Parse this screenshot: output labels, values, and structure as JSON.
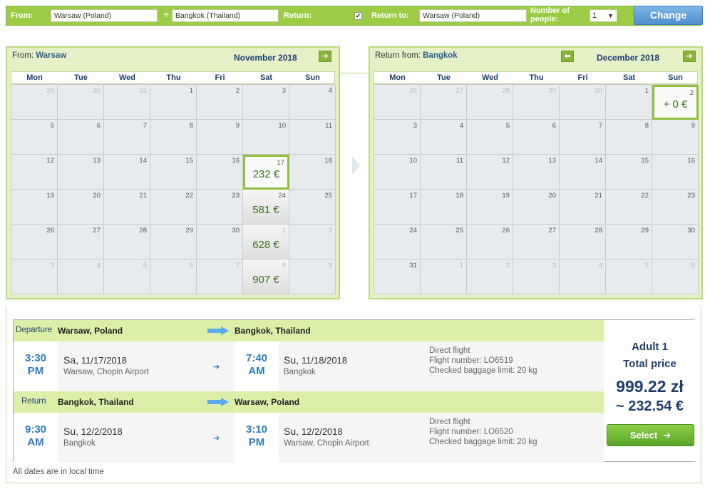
{
  "search": {
    "from_label": "From:",
    "from_value": "Warsaw (Poland)",
    "to_value": "Bangkok (Thailand)",
    "return_label": "Return:",
    "return_checked": true,
    "return_to_label": "Return to:",
    "return_to_value": "Warsaw (Poland)",
    "people_label": "Number of people:",
    "people_value": "1",
    "change_label": "Change"
  },
  "weekdays": [
    "Mon",
    "Tue",
    "Wed",
    "Thu",
    "Fri",
    "Sat",
    "Sun"
  ],
  "outbound_calendar": {
    "prefix": "From:",
    "city": "Warsaw",
    "month": "November 2018",
    "cells": [
      {
        "d": "29",
        "o": true
      },
      {
        "d": "30",
        "o": true
      },
      {
        "d": "31",
        "o": true
      },
      {
        "d": "1"
      },
      {
        "d": "2"
      },
      {
        "d": "3"
      },
      {
        "d": "4"
      },
      {
        "d": "5"
      },
      {
        "d": "6"
      },
      {
        "d": "7"
      },
      {
        "d": "8"
      },
      {
        "d": "9"
      },
      {
        "d": "10"
      },
      {
        "d": "11"
      },
      {
        "d": "12"
      },
      {
        "d": "13"
      },
      {
        "d": "14"
      },
      {
        "d": "15"
      },
      {
        "d": "16"
      },
      {
        "d": "17",
        "p": "232 €",
        "s": true
      },
      {
        "d": "18"
      },
      {
        "d": "19"
      },
      {
        "d": "20"
      },
      {
        "d": "21"
      },
      {
        "d": "22"
      },
      {
        "d": "23"
      },
      {
        "d": "24",
        "p": "581 €"
      },
      {
        "d": "25"
      },
      {
        "d": "26"
      },
      {
        "d": "27"
      },
      {
        "d": "28"
      },
      {
        "d": "29"
      },
      {
        "d": "30"
      },
      {
        "d": "1",
        "o": true,
        "p": "628 €"
      },
      {
        "d": "2",
        "o": true
      },
      {
        "d": "3",
        "o": true
      },
      {
        "d": "4",
        "o": true
      },
      {
        "d": "5",
        "o": true
      },
      {
        "d": "6",
        "o": true
      },
      {
        "d": "7",
        "o": true
      },
      {
        "d": "8",
        "o": true,
        "p": "907 €"
      },
      {
        "d": "9",
        "o": true
      }
    ]
  },
  "return_calendar": {
    "prefix": "Return from:",
    "city": "Bangkok",
    "month": "December 2018",
    "cells": [
      {
        "d": "26",
        "o": true
      },
      {
        "d": "27",
        "o": true
      },
      {
        "d": "28",
        "o": true
      },
      {
        "d": "29",
        "o": true
      },
      {
        "d": "30",
        "o": true
      },
      {
        "d": "1"
      },
      {
        "d": "2",
        "p": "+ 0 €",
        "s": true
      },
      {
        "d": "3"
      },
      {
        "d": "4"
      },
      {
        "d": "5"
      },
      {
        "d": "6"
      },
      {
        "d": "7"
      },
      {
        "d": "8"
      },
      {
        "d": "9"
      },
      {
        "d": "10"
      },
      {
        "d": "11"
      },
      {
        "d": "12"
      },
      {
        "d": "13"
      },
      {
        "d": "14"
      },
      {
        "d": "15"
      },
      {
        "d": "16"
      },
      {
        "d": "17"
      },
      {
        "d": "18"
      },
      {
        "d": "19"
      },
      {
        "d": "20"
      },
      {
        "d": "21"
      },
      {
        "d": "22"
      },
      {
        "d": "23"
      },
      {
        "d": "24"
      },
      {
        "d": "25"
      },
      {
        "d": "26"
      },
      {
        "d": "27"
      },
      {
        "d": "28"
      },
      {
        "d": "29"
      },
      {
        "d": "30"
      },
      {
        "d": "31"
      },
      {
        "d": "1",
        "o": true
      },
      {
        "d": "2",
        "o": true
      },
      {
        "d": "3",
        "o": true
      },
      {
        "d": "4",
        "o": true
      },
      {
        "d": "5",
        "o": true
      },
      {
        "d": "6",
        "o": true
      }
    ]
  },
  "departure": {
    "label": "Departure",
    "from_city": "Warsaw, Poland",
    "to_city": "Bangkok, Thailand",
    "dep_time": "3:30",
    "dep_ampm": "PM",
    "dep_day": "Sa,",
    "dep_date": "11/17/2018",
    "dep_place": "Warsaw, Chopin Airport",
    "arr_time": "7:40",
    "arr_ampm": "AM",
    "arr_day": "Su,",
    "arr_date": "11/18/2018",
    "arr_place": "Bangkok",
    "type": "Direct flight",
    "flight_number": "Flight number: LO6519",
    "baggage": "Checked baggage limit: 20 kg"
  },
  "return": {
    "label": "Return",
    "from_city": "Bangkok, Thailand",
    "to_city": "Warsaw, Poland",
    "dep_time": "9:30",
    "dep_ampm": "AM",
    "dep_day": "Su,",
    "dep_date": "12/2/2018",
    "dep_place": "Bangkok",
    "arr_time": "3:10",
    "arr_ampm": "PM",
    "arr_day": "Su,",
    "arr_date": "12/2/2018",
    "arr_place": "Warsaw, Chopin Airport",
    "type": "Direct flight",
    "flight_number": "Flight number: LO6520",
    "baggage": "Checked baggage limit: 20 kg"
  },
  "price": {
    "adult": "Adult 1",
    "total_label": "Total price",
    "pln": "999.22 zł",
    "eur": "~ 232.54 €",
    "select_label": "Select"
  },
  "footnote": "All dates are in local time",
  "colors": {
    "brand_green": "#9ccc45",
    "header_green": "#dcefa8",
    "time_blue": "#2e7bc4",
    "price_navy": "#1f3f6f",
    "change_blue": "#4d8fcf"
  }
}
